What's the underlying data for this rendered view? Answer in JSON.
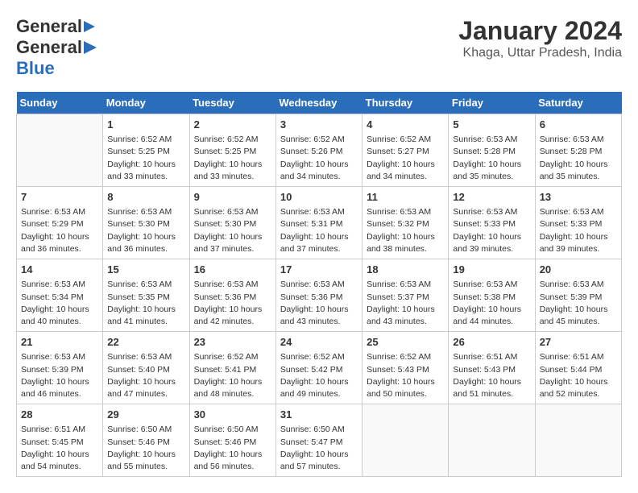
{
  "header": {
    "logo_general": "General",
    "logo_blue": "Blue",
    "month_title": "January 2024",
    "subtitle": "Khaga, Uttar Pradesh, India"
  },
  "days_of_week": [
    "Sunday",
    "Monday",
    "Tuesday",
    "Wednesday",
    "Thursday",
    "Friday",
    "Saturday"
  ],
  "weeks": [
    [
      {
        "day": "",
        "info": ""
      },
      {
        "day": "1",
        "info": "Sunrise: 6:52 AM\nSunset: 5:25 PM\nDaylight: 10 hours\nand 33 minutes."
      },
      {
        "day": "2",
        "info": "Sunrise: 6:52 AM\nSunset: 5:25 PM\nDaylight: 10 hours\nand 33 minutes."
      },
      {
        "day": "3",
        "info": "Sunrise: 6:52 AM\nSunset: 5:26 PM\nDaylight: 10 hours\nand 34 minutes."
      },
      {
        "day": "4",
        "info": "Sunrise: 6:52 AM\nSunset: 5:27 PM\nDaylight: 10 hours\nand 34 minutes."
      },
      {
        "day": "5",
        "info": "Sunrise: 6:53 AM\nSunset: 5:28 PM\nDaylight: 10 hours\nand 35 minutes."
      },
      {
        "day": "6",
        "info": "Sunrise: 6:53 AM\nSunset: 5:28 PM\nDaylight: 10 hours\nand 35 minutes."
      }
    ],
    [
      {
        "day": "7",
        "info": "Sunrise: 6:53 AM\nSunset: 5:29 PM\nDaylight: 10 hours\nand 36 minutes."
      },
      {
        "day": "8",
        "info": "Sunrise: 6:53 AM\nSunset: 5:30 PM\nDaylight: 10 hours\nand 36 minutes."
      },
      {
        "day": "9",
        "info": "Sunrise: 6:53 AM\nSunset: 5:30 PM\nDaylight: 10 hours\nand 37 minutes."
      },
      {
        "day": "10",
        "info": "Sunrise: 6:53 AM\nSunset: 5:31 PM\nDaylight: 10 hours\nand 37 minutes."
      },
      {
        "day": "11",
        "info": "Sunrise: 6:53 AM\nSunset: 5:32 PM\nDaylight: 10 hours\nand 38 minutes."
      },
      {
        "day": "12",
        "info": "Sunrise: 6:53 AM\nSunset: 5:33 PM\nDaylight: 10 hours\nand 39 minutes."
      },
      {
        "day": "13",
        "info": "Sunrise: 6:53 AM\nSunset: 5:33 PM\nDaylight: 10 hours\nand 39 minutes."
      }
    ],
    [
      {
        "day": "14",
        "info": "Sunrise: 6:53 AM\nSunset: 5:34 PM\nDaylight: 10 hours\nand 40 minutes."
      },
      {
        "day": "15",
        "info": "Sunrise: 6:53 AM\nSunset: 5:35 PM\nDaylight: 10 hours\nand 41 minutes."
      },
      {
        "day": "16",
        "info": "Sunrise: 6:53 AM\nSunset: 5:36 PM\nDaylight: 10 hours\nand 42 minutes."
      },
      {
        "day": "17",
        "info": "Sunrise: 6:53 AM\nSunset: 5:36 PM\nDaylight: 10 hours\nand 43 minutes."
      },
      {
        "day": "18",
        "info": "Sunrise: 6:53 AM\nSunset: 5:37 PM\nDaylight: 10 hours\nand 43 minutes."
      },
      {
        "day": "19",
        "info": "Sunrise: 6:53 AM\nSunset: 5:38 PM\nDaylight: 10 hours\nand 44 minutes."
      },
      {
        "day": "20",
        "info": "Sunrise: 6:53 AM\nSunset: 5:39 PM\nDaylight: 10 hours\nand 45 minutes."
      }
    ],
    [
      {
        "day": "21",
        "info": "Sunrise: 6:53 AM\nSunset: 5:39 PM\nDaylight: 10 hours\nand 46 minutes."
      },
      {
        "day": "22",
        "info": "Sunrise: 6:53 AM\nSunset: 5:40 PM\nDaylight: 10 hours\nand 47 minutes."
      },
      {
        "day": "23",
        "info": "Sunrise: 6:52 AM\nSunset: 5:41 PM\nDaylight: 10 hours\nand 48 minutes."
      },
      {
        "day": "24",
        "info": "Sunrise: 6:52 AM\nSunset: 5:42 PM\nDaylight: 10 hours\nand 49 minutes."
      },
      {
        "day": "25",
        "info": "Sunrise: 6:52 AM\nSunset: 5:43 PM\nDaylight: 10 hours\nand 50 minutes."
      },
      {
        "day": "26",
        "info": "Sunrise: 6:51 AM\nSunset: 5:43 PM\nDaylight: 10 hours\nand 51 minutes."
      },
      {
        "day": "27",
        "info": "Sunrise: 6:51 AM\nSunset: 5:44 PM\nDaylight: 10 hours\nand 52 minutes."
      }
    ],
    [
      {
        "day": "28",
        "info": "Sunrise: 6:51 AM\nSunset: 5:45 PM\nDaylight: 10 hours\nand 54 minutes."
      },
      {
        "day": "29",
        "info": "Sunrise: 6:50 AM\nSunset: 5:46 PM\nDaylight: 10 hours\nand 55 minutes."
      },
      {
        "day": "30",
        "info": "Sunrise: 6:50 AM\nSunset: 5:46 PM\nDaylight: 10 hours\nand 56 minutes."
      },
      {
        "day": "31",
        "info": "Sunrise: 6:50 AM\nSunset: 5:47 PM\nDaylight: 10 hours\nand 57 minutes."
      },
      {
        "day": "",
        "info": ""
      },
      {
        "day": "",
        "info": ""
      },
      {
        "day": "",
        "info": ""
      }
    ]
  ]
}
